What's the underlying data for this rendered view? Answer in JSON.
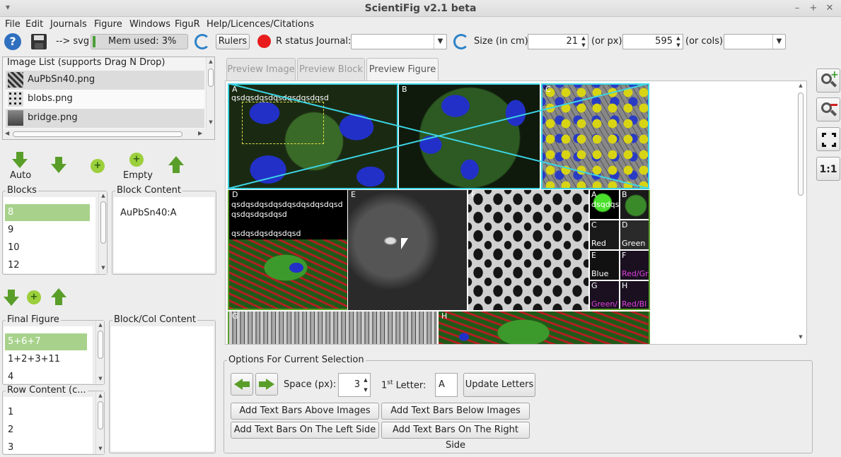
{
  "window": {
    "title": "ScientiFig v2.1 beta",
    "min": "–",
    "max": "+",
    "close": "✕",
    "menu_glyph": "▾"
  },
  "menu": [
    "File",
    "Edit",
    "Journals",
    "Figure",
    "Windows",
    "FiguR",
    "Help/Licences/Citations"
  ],
  "toolbar": {
    "export_label": "--> svg",
    "mem_label": "Mem used: 3%",
    "rulers_label": "Rulers",
    "r_status_label": "R status",
    "journal_label": "Journal:",
    "journal_value": "",
    "size_label": "Size (in cm):",
    "size_cm": "21",
    "or_px_label": "(or px):",
    "size_px": "595",
    "or_cols_label": "(or cols)",
    "cols_value": ""
  },
  "image_list": {
    "title": "Image List (supports Drag N Drop)",
    "items": [
      "AuPbSn40.png",
      "blobs.png",
      "bridge.png"
    ]
  },
  "block_tools": {
    "auto_label": "Auto",
    "empty_label": "Empty"
  },
  "blocks": {
    "title": "Blocks",
    "items": [
      "8",
      "9",
      "10",
      "12"
    ],
    "selected": "8"
  },
  "block_content": {
    "title": "Block Content",
    "items": [
      "AuPbSn40:A"
    ]
  },
  "final_figure": {
    "title": "Final Figure",
    "items": [
      "5+6+7",
      "1+2+3+11",
      "4"
    ],
    "selected": "5+6+7"
  },
  "block_col_content": {
    "title": "Block/Col Content"
  },
  "row_content": {
    "title": "Row Content (c...",
    "items": [
      "1",
      "2",
      "3"
    ]
  },
  "tabs": [
    "Preview Image",
    "Preview Block",
    "Preview Figure"
  ],
  "active_tab": "Preview Figure",
  "preview": {
    "panel_a_letter": "A",
    "panel_a_text": "qsdqsdqsdqsdqsdqsdqsd",
    "panel_b_letter": "B",
    "panel_c_letter": "C",
    "panel_d_letter": "D",
    "panel_d_text1": "qsdqsdqsdqsdqsdqsdqsdqsd",
    "panel_d_text2": "qsdqsdqsdqsd",
    "panel_d_text3": "qsdqsdqsdqsdqsd",
    "panel_e_letter": "E",
    "panel_f_letter": "F",
    "panel_g_letter": "G",
    "panel_h_letter": "H",
    "mini": [
      {
        "letter": "A",
        "label": "dsqdqs",
        "color": "#fff"
      },
      {
        "letter": "B",
        "label": "",
        "color": "#fff"
      },
      {
        "letter": "C",
        "label": "Red",
        "color": "#fff"
      },
      {
        "letter": "D",
        "label": "Green",
        "color": "#fff"
      },
      {
        "letter": "E",
        "label": "Blue",
        "color": "#fff"
      },
      {
        "letter": "F",
        "label": "Red/Gr",
        "color": "#e040e0"
      },
      {
        "letter": "G",
        "label": "Green/",
        "color": "#e040e0"
      },
      {
        "letter": "H",
        "label": "Red/Bl",
        "color": "#e040e0"
      }
    ]
  },
  "options": {
    "title": "Options For Current Selection",
    "space_label": "Space (px):",
    "space_value": "3",
    "first_letter_label": "1",
    "first_letter_sup": "st",
    "letter_label": " Letter:",
    "first_letter_value": "A",
    "update_letters": "Update Letters",
    "add_above": "Add Text Bars Above Images",
    "add_below": "Add Text Bars Below Images",
    "add_left": "Add Text Bars On The Left Side",
    "add_right": "Add Text Bars On The Right Side"
  },
  "zoom": {
    "one_to_one": "1:1"
  },
  "colors": {
    "selection": "#a8d28c",
    "accent_green": "#5a9e2a",
    "frame_cyan": "#3cd6e6"
  }
}
